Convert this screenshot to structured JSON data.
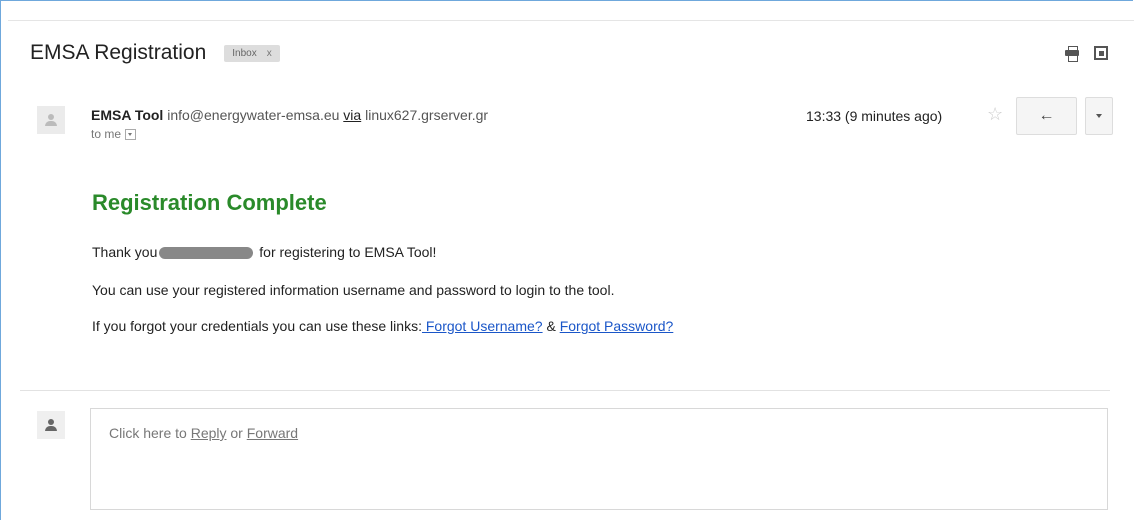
{
  "email": {
    "subject": "EMSA Registration",
    "label": {
      "name": "Inbox",
      "close": "x"
    },
    "toolbar": {
      "print_icon": "print-icon",
      "newwindow_icon": "new-window-icon"
    },
    "sender": {
      "name": "EMSA Tool",
      "email": "info@energywater-emsa.eu",
      "via_label": "via",
      "via_server": "linux627.grserver.gr",
      "to": "to me"
    },
    "time": "13:33 (9 minutes ago)",
    "star_glyph": "☆",
    "reply_glyph": "🡐"
  },
  "body": {
    "heading": "Registration Complete",
    "thank_pre": "Thank you",
    "thank_post": "for registering to EMSA Tool!",
    "line2": "You can use your registered information username and password to login to the tool.",
    "line3_pre": "If you forgot your credentials you can use these links:",
    "forgot_username": " Forgot Username?",
    "amp": " & ",
    "forgot_password": "Forgot Password?"
  },
  "reply_box": {
    "prefix": "Click here to ",
    "reply": "Reply",
    "or": " or ",
    "forward": "Forward"
  },
  "colors": {
    "heading": "#2a8a2a",
    "link": "#1a56c8",
    "frame": "#6fa8dc"
  }
}
